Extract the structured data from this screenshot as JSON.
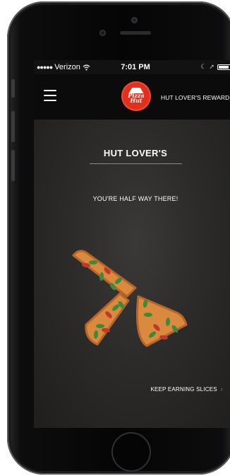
{
  "status_bar": {
    "carrier": "Verizon",
    "time": "7:01 PM",
    "battery_level": 0.9
  },
  "nav": {
    "logo_text_line1": "Pizza",
    "logo_text_line2": "Hut",
    "rewards_label": "HUT LOVER'S REWARDS"
  },
  "content": {
    "title": "HUT LOVER'S",
    "subtitle": "YOU'RE HALF WAY THERE!",
    "slices_earned": 3,
    "cta_label": "KEEP EARNING SLICES",
    "cta_chevron": "›"
  },
  "icons": {
    "menu": "hamburger-icon",
    "wifi": "wifi-icon",
    "battery": "battery-icon",
    "chevron": "chevron-right-icon"
  },
  "colors": {
    "brand_red": "#e0301e",
    "background": "#2c2b2a"
  }
}
